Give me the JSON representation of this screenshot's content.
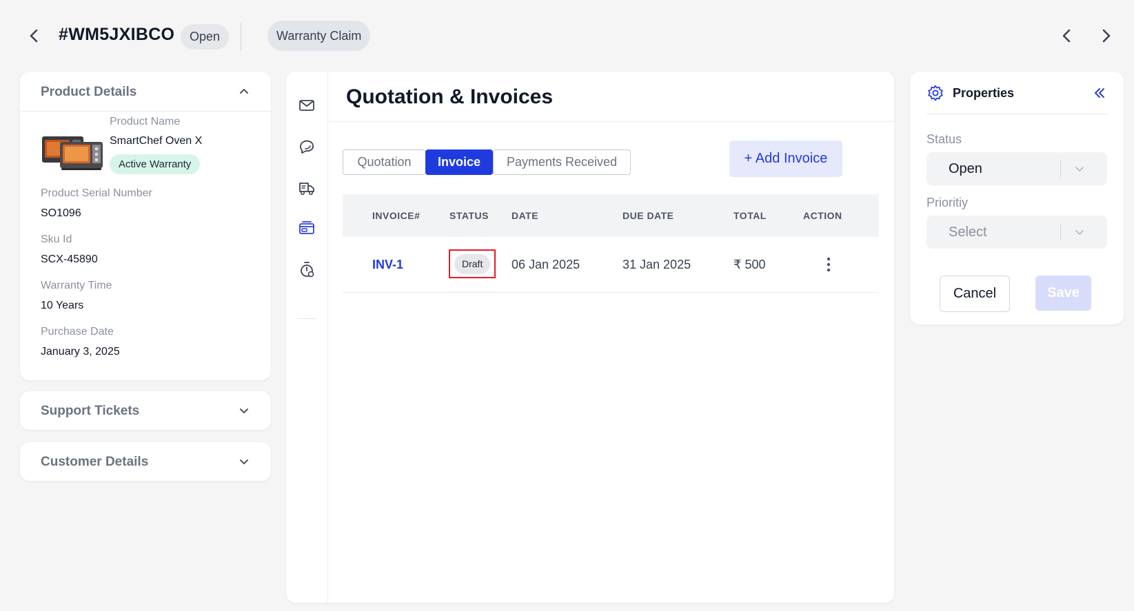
{
  "header": {
    "ticket_id": "#WM5JXIBCO",
    "status": "Open",
    "category": "Warranty Claim"
  },
  "product_details": {
    "title": "Product Details",
    "product_name_label": "Product Name",
    "product_name": "SmartChef Oven X",
    "warranty_badge": "Active Warranty",
    "serial_label": "Product Serial Number",
    "serial": "SO1096",
    "sku_label": "Sku Id",
    "sku": "SCX-45890",
    "warranty_time_label": "Warranty Time",
    "warranty_time": "10 Years",
    "purchase_date_label": "Purchase Date",
    "purchase_date": "January 3, 2025"
  },
  "support_tickets": {
    "title": "Support Tickets"
  },
  "customer_details": {
    "title": "Customer Details"
  },
  "main": {
    "title": "Quotation & Invoices",
    "tabs": [
      "Quotation",
      "Invoice",
      "Payments Received"
    ],
    "active_tab": "Invoice",
    "add_button": "+ Add Invoice",
    "rail_icons": [
      "mail-icon",
      "chat-icon",
      "delivery-truck-icon",
      "payment-card-icon",
      "timer-icon"
    ],
    "table": {
      "headers": [
        "INVOICE#",
        "STATUS",
        "DATE",
        "DUE DATE",
        "TOTAL",
        "ACTION"
      ],
      "rows": [
        {
          "invoice": "INV-1",
          "status": "Draft",
          "date": "06 Jan 2025",
          "due_date": "31 Jan 2025",
          "total": "₹ 500"
        }
      ]
    }
  },
  "properties": {
    "title": "Properties",
    "status_label": "Status",
    "status_value": "Open",
    "priority_label": "Prioritiy",
    "priority_value": "Select",
    "cancel": "Cancel",
    "save": "Save"
  },
  "colors": {
    "accent": "#1f3be0",
    "warranty_badge_bg": "#d6f5e8",
    "highlight_border": "#e11d2a"
  }
}
